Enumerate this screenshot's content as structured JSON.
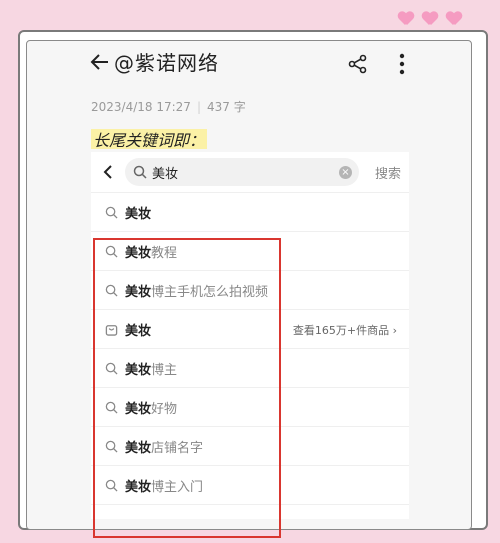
{
  "header": {
    "title": "@紫诺网络",
    "date": "2023/4/18 17:27",
    "word_count": "437 字"
  },
  "highlight": "长尾关键词即：",
  "search": {
    "query": "美妆",
    "button": "搜索"
  },
  "suggestions": [
    {
      "bold": "美妆",
      "rest": ""
    },
    {
      "bold": "美妆",
      "rest": "教程"
    },
    {
      "bold": "美妆",
      "rest": "博主手机怎么拍视频"
    },
    {
      "bold": "美妆",
      "rest": "",
      "extra": "查看165万+件商品 ›"
    },
    {
      "bold": "美妆",
      "rest": "博主"
    },
    {
      "bold": "美妆",
      "rest": "好物"
    },
    {
      "bold": "美妆",
      "rest": "店铺名字"
    },
    {
      "bold": "美妆",
      "rest": "博主入门"
    }
  ],
  "colors": {
    "background": "#f7d7e2",
    "highlight": "#fbf1a6",
    "annotation": "#d9362f",
    "hearts": "#f59bc1"
  }
}
